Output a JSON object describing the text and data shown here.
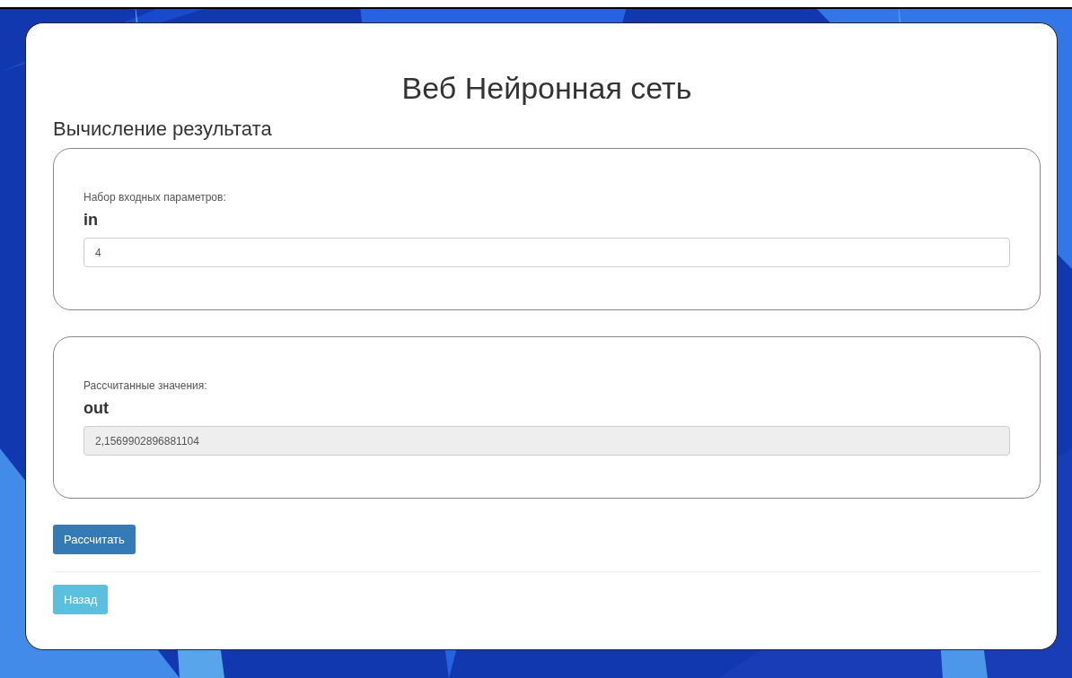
{
  "title": "Веб Нейронная сеть",
  "section_heading": "Вычисление результата",
  "panels": [
    {
      "caption": "Набор входных параметров:",
      "field_label": "in",
      "value": "4",
      "readonly": false
    },
    {
      "caption": "Рассчитанные значения:",
      "field_label": "out",
      "value": "2,1569902896881104",
      "readonly": true
    }
  ],
  "calculate_button": "Рассчитать",
  "back_button": "Назад"
}
